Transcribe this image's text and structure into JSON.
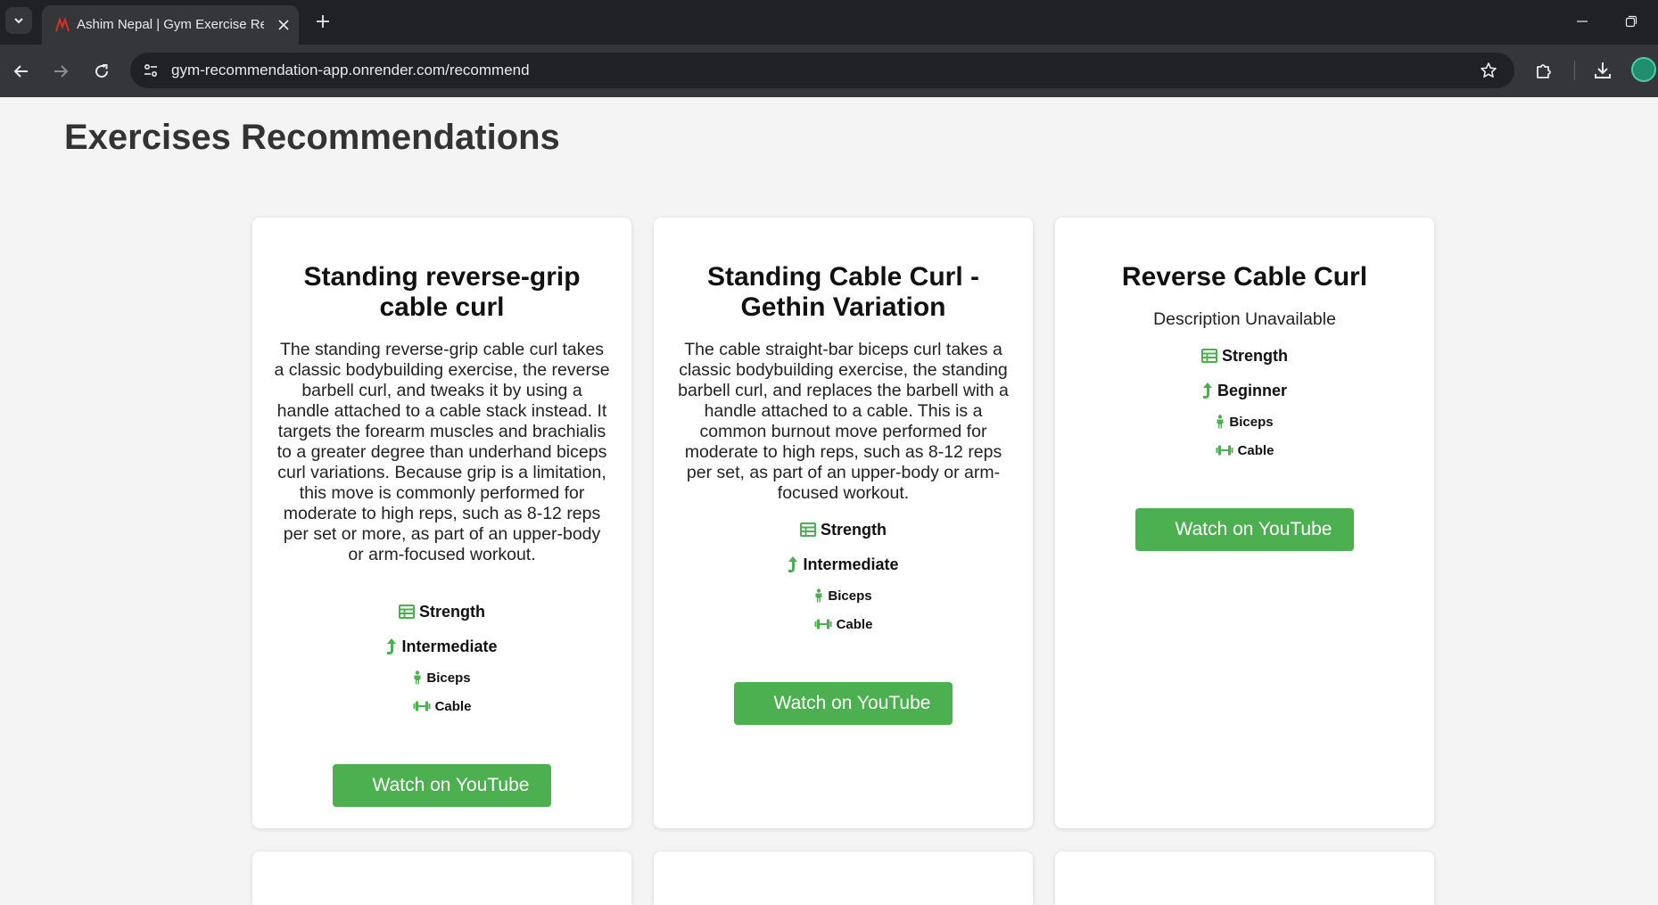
{
  "browser": {
    "tab_title": "Ashim Nepal | Gym Exercise Recommendation",
    "url": "gym-recommendation-app.onrender.com/recommend"
  },
  "page": {
    "title": "Exercises Recommendations"
  },
  "cards": [
    {
      "title": "Standing reverse-grip cable curl",
      "description": "The standing reverse-grip cable curl takes a classic bodybuilding exercise, the reverse barbell curl, and tweaks it by using a handle attached to a cable stack instead. It targets the forearm muscles and brachialis to a greater degree than underhand biceps curl variations. Because grip is a limitation, this move is commonly performed for moderate to high reps, such as 8-12 reps per set or more, as part of an upper-body or arm-focused workout.",
      "type": "Strength",
      "level": "Intermediate",
      "body_part": "Biceps",
      "equipment": "Cable",
      "button": "Watch on YouTube"
    },
    {
      "title": "Standing Cable Curl - Gethin Variation",
      "description": "The cable straight-bar biceps curl takes a classic bodybuilding exercise, the standing barbell curl, and replaces the barbell with a handle attached to a cable. This is a common burnout move performed for moderate to high reps, such as 8-12 reps per set, as part of an upper-body or arm-focused workout.",
      "type": "Strength",
      "level": "Intermediate",
      "body_part": "Biceps",
      "equipment": "Cable",
      "button": "Watch on YouTube"
    },
    {
      "title": "Reverse Cable Curl",
      "description": "Description Unavailable",
      "type": "Strength",
      "level": "Beginner",
      "body_part": "Biceps",
      "equipment": "Cable",
      "button": "Watch on YouTube"
    }
  ],
  "colors": {
    "accent": "#4caf50",
    "page_bg": "#f4f4f4",
    "chrome_dark": "#202124",
    "chrome_toolbar": "#35363a"
  }
}
